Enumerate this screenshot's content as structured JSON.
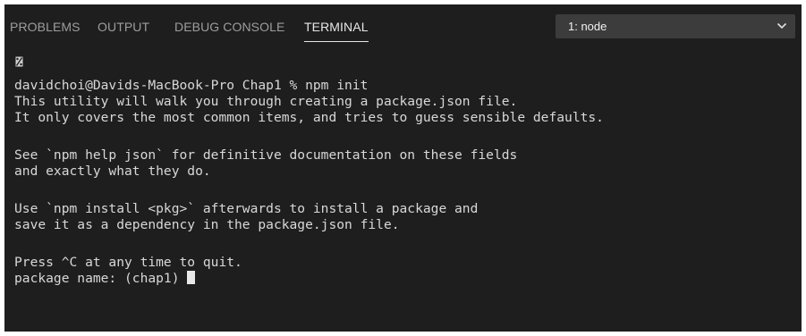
{
  "tabs": [
    {
      "label": "PROBLEMS",
      "active": false
    },
    {
      "label": "OUTPUT",
      "active": false
    },
    {
      "label": "DEBUG CONSOLE",
      "active": false
    },
    {
      "label": "TERMINAL",
      "active": true
    }
  ],
  "terminal_select": {
    "value": "1: node",
    "icon": "chevron-down-icon"
  },
  "terminal": {
    "lines": [
      "davidchoi@Davids-MacBook-Pro Chap1 % npm init",
      "This utility will walk you through creating a package.json file.",
      "It only covers the most common items, and tries to guess sensible defaults.",
      "See `npm help json` for definitive documentation on these fields",
      "and exactly what they do.",
      "Use `npm install <pkg>` afterwards to install a package and",
      "save it as a dependency in the package.json file.",
      "Press ^C at any time to quit.",
      "package name: (chap1) "
    ]
  },
  "colors": {
    "background": "#1e1e1e",
    "text": "#d8d8d8",
    "tab_inactive": "#9d9d9d",
    "tab_active": "#e7e7e7",
    "dropdown": "#3c3c3c"
  }
}
